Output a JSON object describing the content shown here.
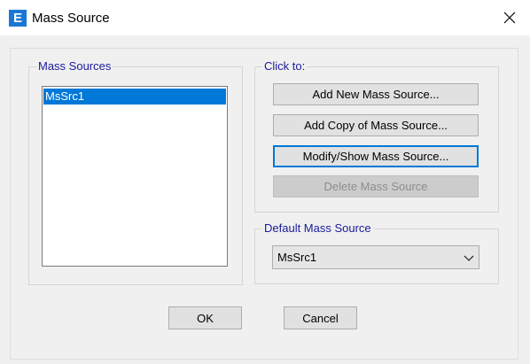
{
  "window": {
    "title": "Mass Source",
    "app_icon_letter": "E"
  },
  "mass_sources_group": {
    "label": "Mass Sources",
    "items": [
      "MsSrc1"
    ],
    "selected": "MsSrc1"
  },
  "click_to_group": {
    "label": "Click to:",
    "buttons": {
      "add_new": "Add New Mass Source...",
      "add_copy": "Add Copy of Mass Source...",
      "modify_show": "Modify/Show Mass Source...",
      "delete": "Delete Mass Source"
    }
  },
  "default_group": {
    "label": "Default Mass Source",
    "selected_value": "MsSrc1"
  },
  "footer": {
    "ok_label": "OK",
    "cancel_label": "Cancel"
  },
  "colors": {
    "accent": "#0078d7",
    "group_label": "#1a1a9a",
    "app_icon": "#1878d4"
  },
  "icons": {
    "close": "close-icon",
    "combo_arrow": "chevron-down-icon"
  }
}
